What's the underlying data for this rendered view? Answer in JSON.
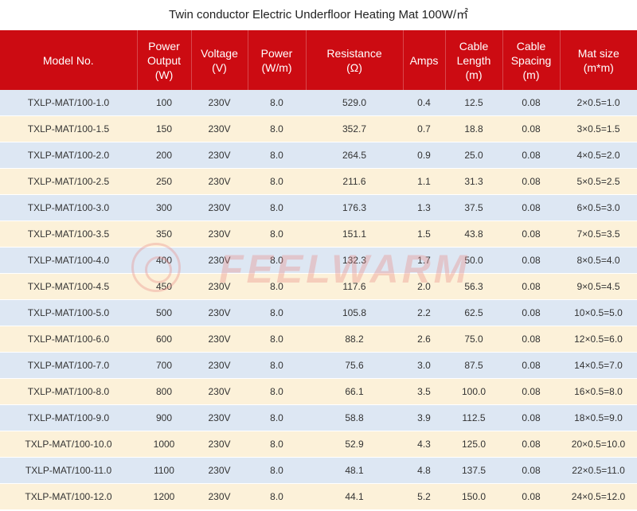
{
  "title": "Twin conductor Electric Underfloor Heating Mat 100W/㎡",
  "headers": [
    "Model No.",
    "Power\nOutput\n(W)",
    "Voltage\n(V)",
    "Power\n(W/m)",
    "Resistance\n(Ω)",
    "Amps",
    "Cable\nLength\n(m)",
    "Cable\nSpacing\n(m)",
    "Mat size\n(m*m)"
  ],
  "rows": [
    [
      "TXLP-MAT/100-1.0",
      "100",
      "230V",
      "8.0",
      "529.0",
      "0.4",
      "12.5",
      "0.08",
      "2×0.5=1.0"
    ],
    [
      "TXLP-MAT/100-1.5",
      "150",
      "230V",
      "8.0",
      "352.7",
      "0.7",
      "18.8",
      "0.08",
      "3×0.5=1.5"
    ],
    [
      "TXLP-MAT/100-2.0",
      "200",
      "230V",
      "8.0",
      "264.5",
      "0.9",
      "25.0",
      "0.08",
      "4×0.5=2.0"
    ],
    [
      "TXLP-MAT/100-2.5",
      "250",
      "230V",
      "8.0",
      "211.6",
      "1.1",
      "31.3",
      "0.08",
      "5×0.5=2.5"
    ],
    [
      "TXLP-MAT/100-3.0",
      "300",
      "230V",
      "8.0",
      "176.3",
      "1.3",
      "37.5",
      "0.08",
      "6×0.5=3.0"
    ],
    [
      "TXLP-MAT/100-3.5",
      "350",
      "230V",
      "8.0",
      "151.1",
      "1.5",
      "43.8",
      "0.08",
      "7×0.5=3.5"
    ],
    [
      "TXLP-MAT/100-4.0",
      "400",
      "230V",
      "8.0",
      "132.3",
      "1.7",
      "50.0",
      "0.08",
      "8×0.5=4.0"
    ],
    [
      "TXLP-MAT/100-4.5",
      "450",
      "230V",
      "8.0",
      "117.6",
      "2.0",
      "56.3",
      "0.08",
      "9×0.5=4.5"
    ],
    [
      "TXLP-MAT/100-5.0",
      "500",
      "230V",
      "8.0",
      "105.8",
      "2.2",
      "62.5",
      "0.08",
      "10×0.5=5.0"
    ],
    [
      "TXLP-MAT/100-6.0",
      "600",
      "230V",
      "8.0",
      "88.2",
      "2.6",
      "75.0",
      "0.08",
      "12×0.5=6.0"
    ],
    [
      "TXLP-MAT/100-7.0",
      "700",
      "230V",
      "8.0",
      "75.6",
      "3.0",
      "87.5",
      "0.08",
      "14×0.5=7.0"
    ],
    [
      "TXLP-MAT/100-8.0",
      "800",
      "230V",
      "8.0",
      "66.1",
      "3.5",
      "100.0",
      "0.08",
      "16×0.5=8.0"
    ],
    [
      "TXLP-MAT/100-9.0",
      "900",
      "230V",
      "8.0",
      "58.8",
      "3.9",
      "112.5",
      "0.08",
      "18×0.5=9.0"
    ],
    [
      "TXLP-MAT/100-10.0",
      "1000",
      "230V",
      "8.0",
      "52.9",
      "4.3",
      "125.0",
      "0.08",
      "20×0.5=10.0"
    ],
    [
      "TXLP-MAT/100-11.0",
      "1100",
      "230V",
      "8.0",
      "48.1",
      "4.8",
      "137.5",
      "0.08",
      "22×0.5=11.0"
    ],
    [
      "TXLP-MAT/100-12.0",
      "1200",
      "230V",
      "8.0",
      "44.1",
      "5.2",
      "150.0",
      "0.08",
      "24×0.5=12.0"
    ]
  ],
  "watermark": "FEELWARM",
  "colors": {
    "header_bg": "#cc0b12",
    "row_odd": "#dde7f3",
    "row_even": "#fcf1d9",
    "watermark": "#e98b86"
  }
}
